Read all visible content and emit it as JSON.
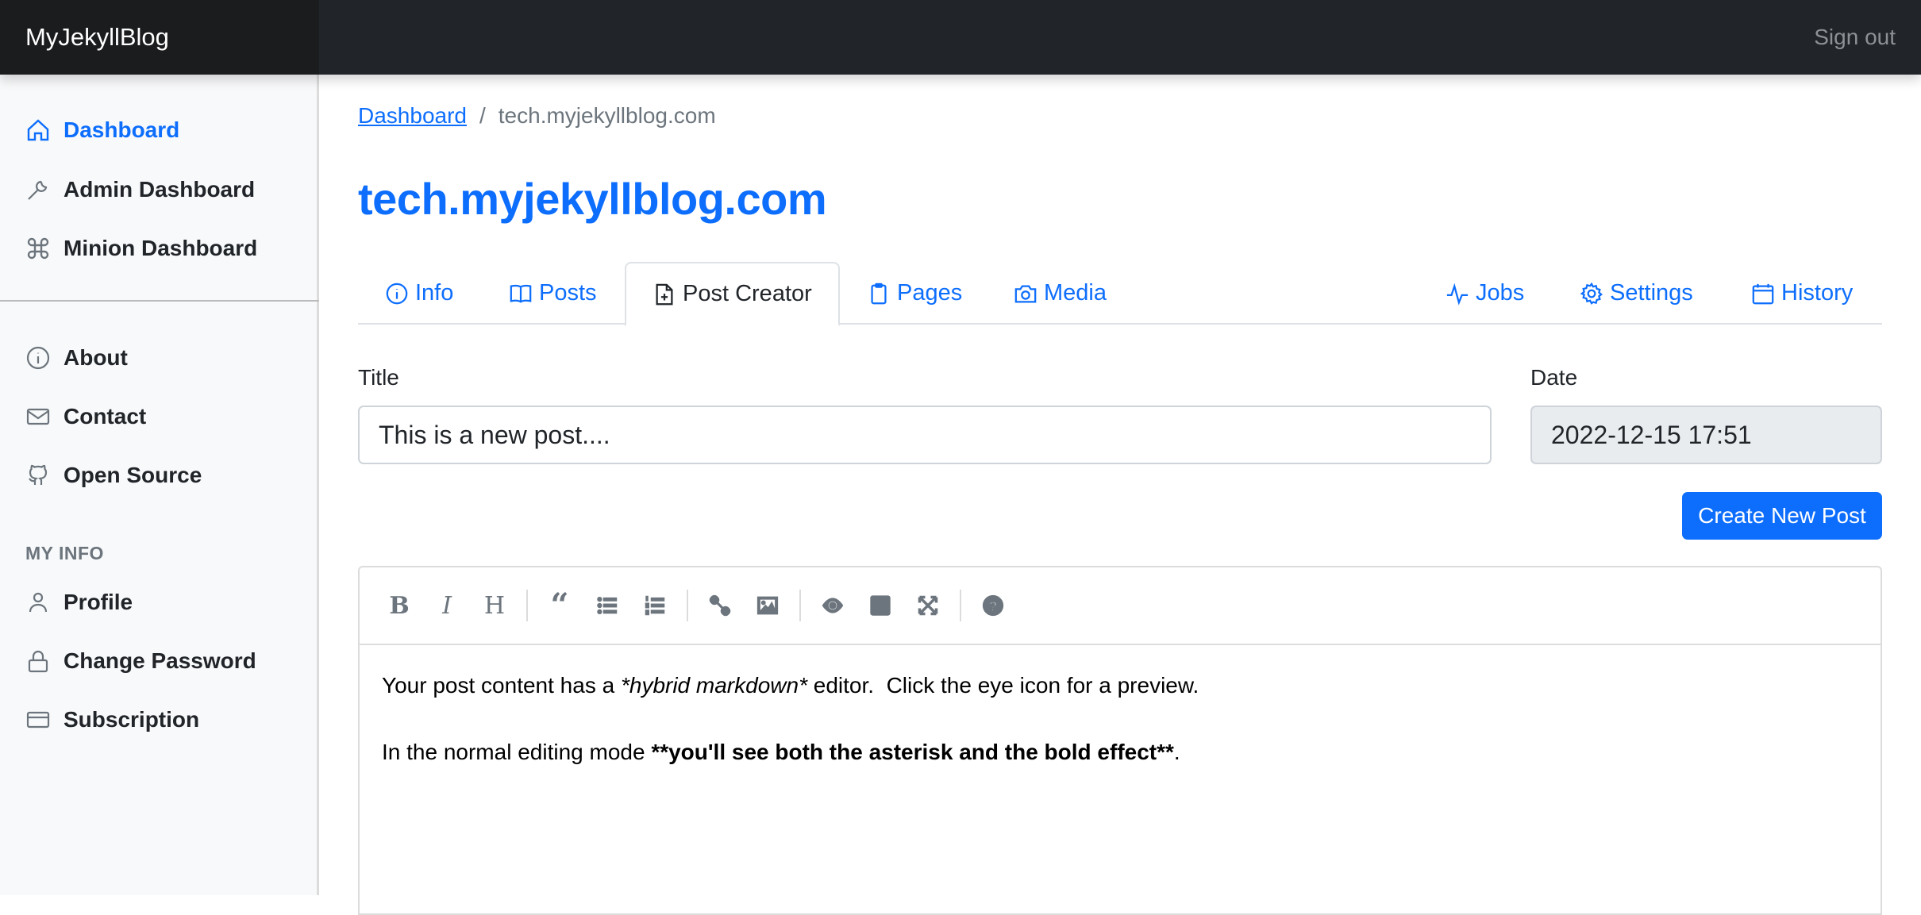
{
  "header": {
    "brand": "MyJekyllBlog",
    "signout": "Sign out"
  },
  "sidebar": {
    "primary": [
      {
        "label": "Dashboard",
        "icon": "house-icon",
        "active": true
      },
      {
        "label": "Admin Dashboard",
        "icon": "wrench-icon"
      },
      {
        "label": "Minion Dashboard",
        "icon": "command-icon"
      }
    ],
    "secondary": [
      {
        "label": "About",
        "icon": "info-circle-icon"
      },
      {
        "label": "Contact",
        "icon": "envelope-icon"
      },
      {
        "label": "Open Source",
        "icon": "github-icon"
      }
    ],
    "section_heading": "MY INFO",
    "my_info": [
      {
        "label": "Profile",
        "icon": "person-icon"
      },
      {
        "label": "Change Password",
        "icon": "lock-icon"
      },
      {
        "label": "Subscription",
        "icon": "credit-card-icon"
      }
    ]
  },
  "breadcrumb": {
    "home": "Dashboard",
    "separator": "/",
    "current": "tech.myjekyllblog.com"
  },
  "page_title": "tech.myjekyllblog.com",
  "tabs": [
    {
      "label": "Info",
      "icon": "info-circle-icon"
    },
    {
      "label": "Posts",
      "icon": "book-icon"
    },
    {
      "label": "Post Creator",
      "icon": "file-plus-icon",
      "active": true
    },
    {
      "label": "Pages",
      "icon": "clipboard-icon"
    },
    {
      "label": "Media",
      "icon": "camera-icon"
    },
    {
      "label": "Jobs",
      "icon": "activity-icon"
    },
    {
      "label": "Settings",
      "icon": "gear-icon"
    },
    {
      "label": "History",
      "icon": "calendar-icon"
    }
  ],
  "form": {
    "title_label": "Title",
    "title_value": "This is a new post....",
    "date_label": "Date",
    "date_value": "2022-12-15 17:51",
    "create_button": "Create New Post"
  },
  "editor": {
    "toolbar": [
      "bold",
      "italic",
      "heading",
      "quote",
      "unordered-list",
      "ordered-list",
      "link",
      "image",
      "preview",
      "side-by-side",
      "fullscreen",
      "guide"
    ],
    "line1": {
      "before": "Your post content has a ",
      "italic": "*hybrid markdown*",
      "after": " editor.  Click the eye icon for a preview."
    },
    "line2": {
      "before": "In the normal editing mode ",
      "bold": "**you'll see both the asterisk and the bold effect**",
      "after": "."
    }
  }
}
